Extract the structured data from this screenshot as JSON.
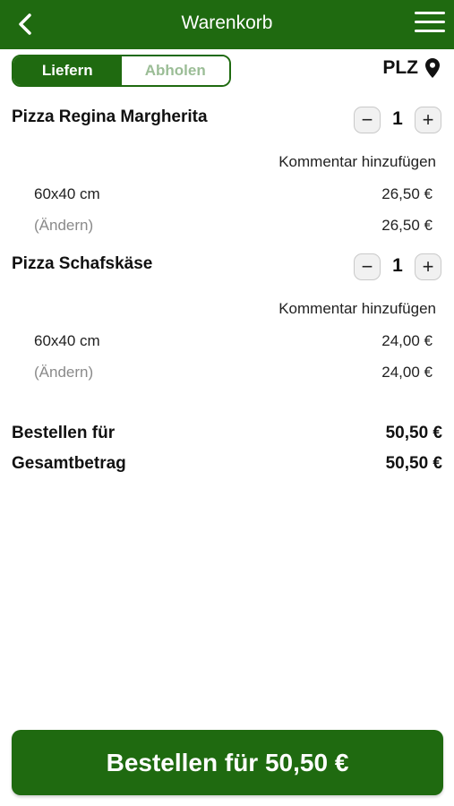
{
  "colors": {
    "brand": "#1f6a10",
    "inactive_tab_text": "#9bbd96",
    "muted": "#8a8a8a"
  },
  "header": {
    "title": "Warenkorb",
    "back_icon": "chevron-left-icon",
    "menu_icon": "hamburger-menu-icon"
  },
  "delivery_toggle": {
    "options": [
      "Liefern",
      "Abholen"
    ],
    "selected": "Liefern"
  },
  "plz": {
    "label": "PLZ",
    "icon": "map-pin-icon"
  },
  "cart": {
    "items": [
      {
        "name": "Pizza Regina Margherita",
        "quantity": "1",
        "comment_label": "Kommentar hinzufügen",
        "size": "60x40 cm",
        "size_price": "26,50 €",
        "change_label": "(Ändern)",
        "item_total": "26,50 €"
      },
      {
        "name": "Pizza Schafskäse",
        "quantity": "1",
        "comment_label": "Kommentar hinzufügen",
        "size": "60x40 cm",
        "size_price": "24,00 €",
        "change_label": "(Ändern)",
        "item_total": "24,00 €"
      }
    ]
  },
  "summary": {
    "order_for_label": "Bestellen für",
    "order_for_value": "50,50 €",
    "total_label": "Gesamtbetrag",
    "total_value": "50,50 €"
  },
  "order_button": {
    "label": "Bestellen für 50,50 €"
  }
}
